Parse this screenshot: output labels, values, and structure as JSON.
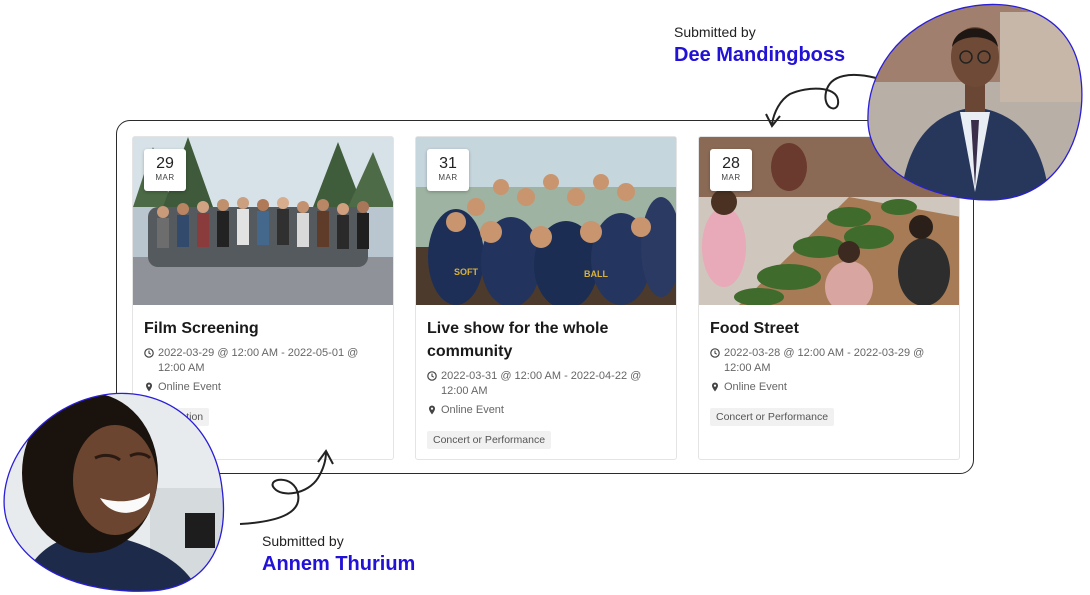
{
  "events": [
    {
      "day": "29",
      "month": "MAR",
      "title": "Film Screening",
      "datetime": "2022-03-29 @ 12:00 AM - 2022-05-01 @ 12:00 AM",
      "location": "Online Event",
      "tag": "Convention"
    },
    {
      "day": "31",
      "month": "MAR",
      "title": "Live show for the whole community",
      "datetime": "2022-03-31 @ 12:00 AM - 2022-04-22 @ 12:00 AM",
      "location": "Online Event",
      "tag": "Concert or Performance"
    },
    {
      "day": "28",
      "month": "MAR",
      "title": "Food Street",
      "datetime": "2022-03-28 @ 12:00 AM - 2022-03-29 @ 12:00 AM",
      "location": "Online Event",
      "tag": "Concert or Performance"
    }
  ],
  "submitters": {
    "top": {
      "label": "Submitted by",
      "name": "Dee Mandingboss"
    },
    "bottom": {
      "label": "Submitted by",
      "name": "Annem Thurium"
    }
  },
  "icons": {
    "clock": "clock-icon",
    "location": "map-pin-icon"
  },
  "colors": {
    "accent": "#2212d6",
    "tag_bg": "#f1f1f1",
    "frame_border": "#2b2b2b"
  }
}
